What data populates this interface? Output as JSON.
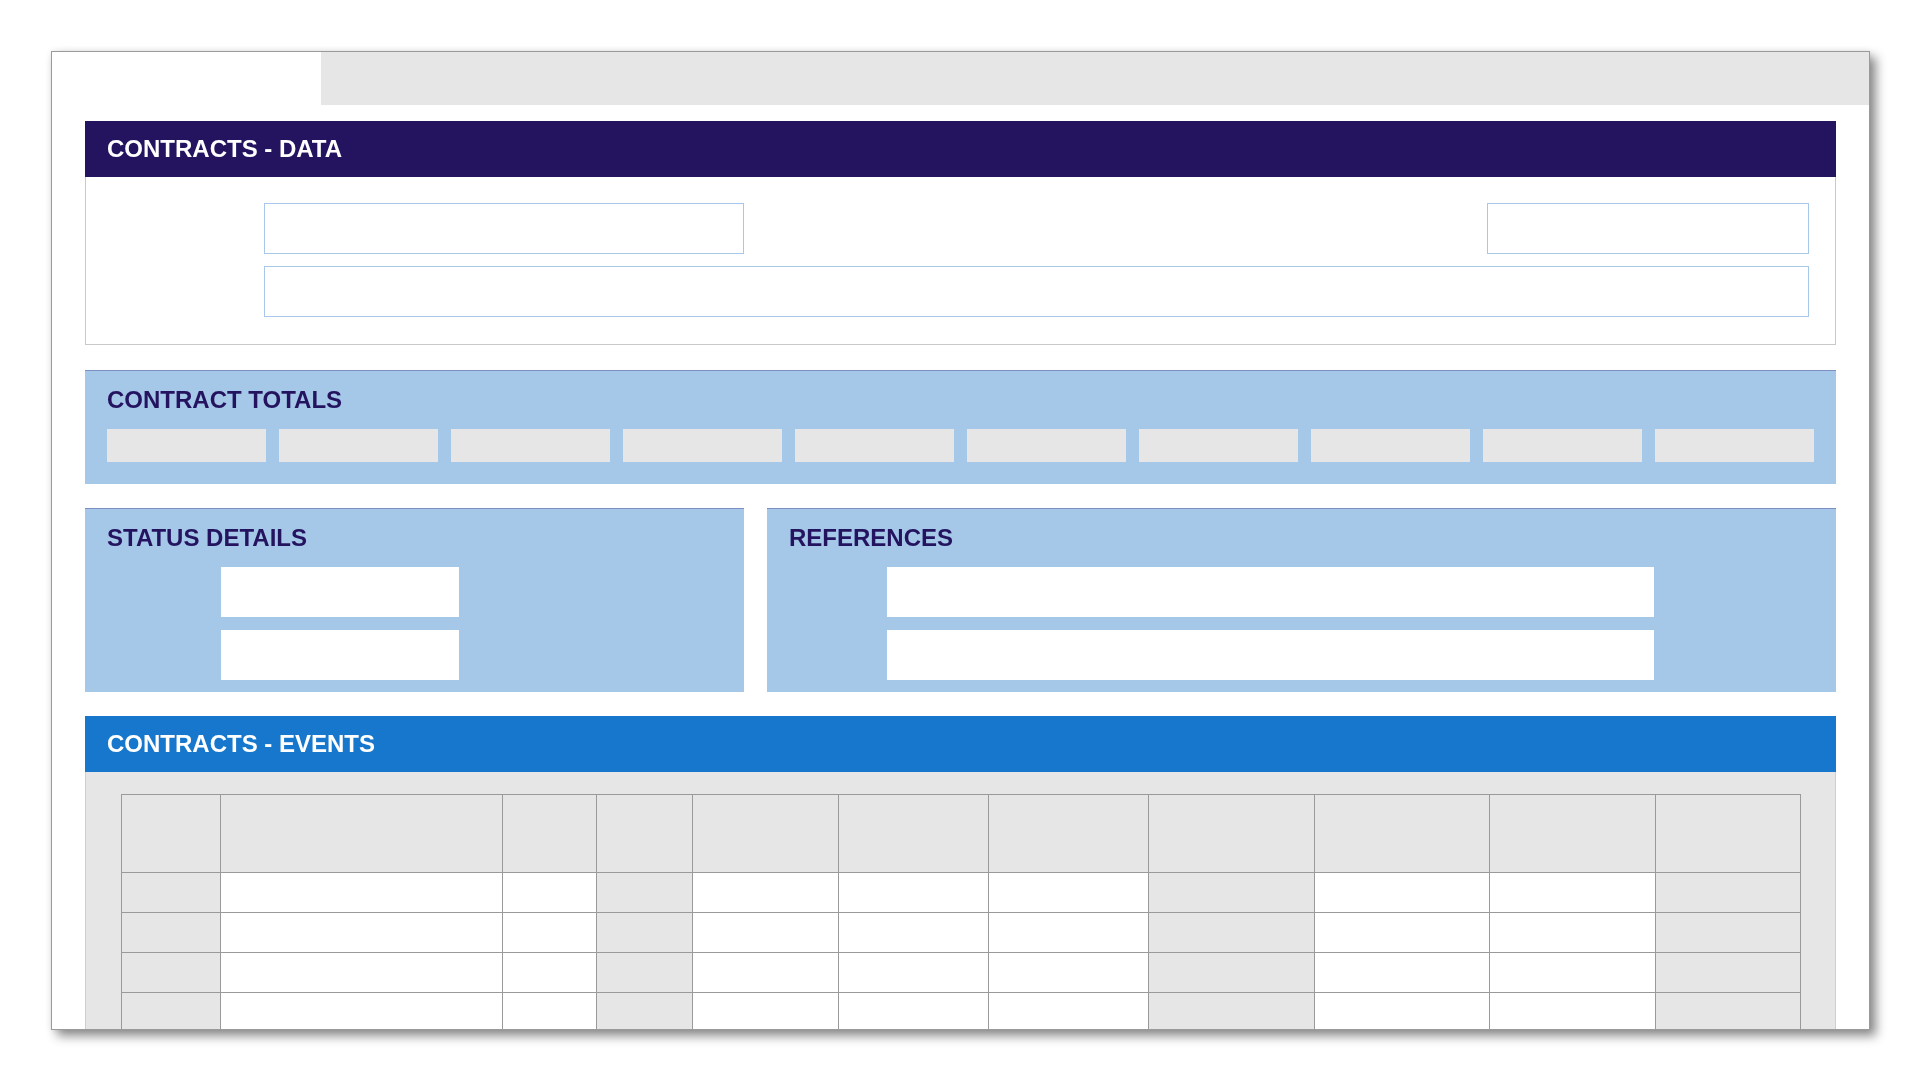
{
  "contracts_data": {
    "title": "CONTRACTS - DATA"
  },
  "contract_totals": {
    "title": "CONTRACT TOTALS"
  },
  "status_details": {
    "title": "STATUS DETAILS"
  },
  "references": {
    "title": "REFERENCES"
  },
  "contracts_events": {
    "title": "CONTRACTS - EVENTS"
  }
}
